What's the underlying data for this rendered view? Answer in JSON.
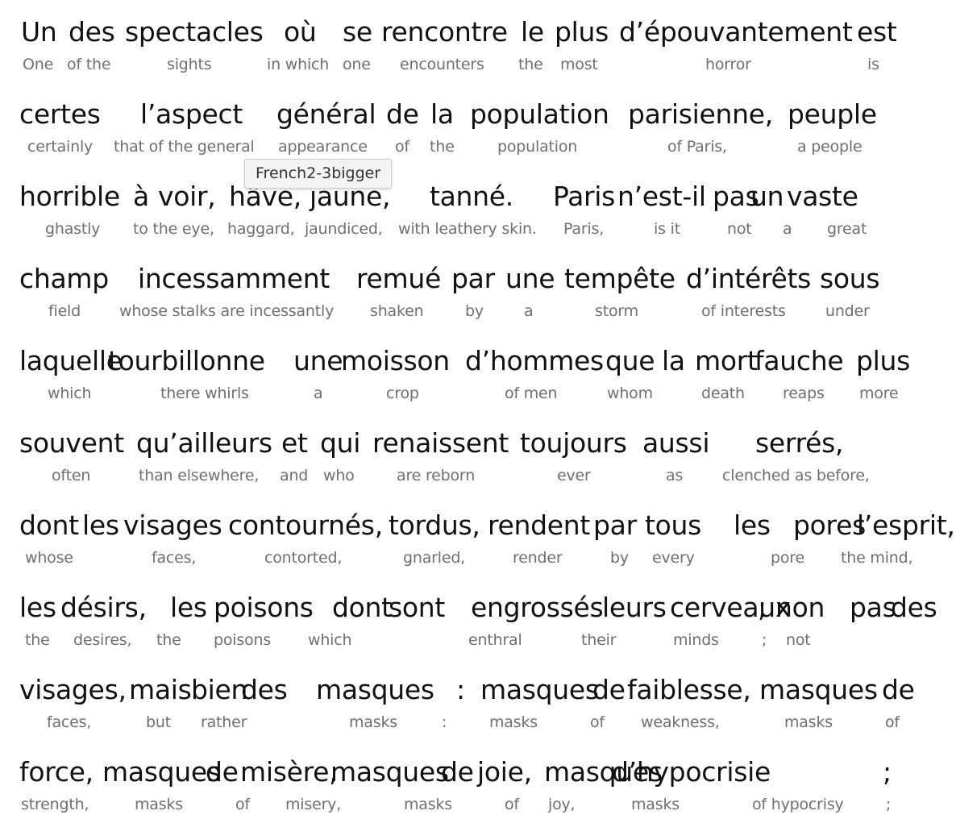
{
  "tooltip": "French2-3bigger",
  "lines": [
    {
      "fr": [
        "Un",
        "des",
        "spectacles",
        "où",
        "se",
        "rencontre",
        "le",
        "plus",
        "d’épouvantement",
        "est"
      ],
      "en": [
        "One",
        "of the",
        "sights",
        "in which",
        "one",
        "encounters",
        "the",
        "most",
        "horror",
        "is"
      ]
    },
    {
      "fr": [
        "certes",
        "l’aspect",
        "général",
        "de",
        "la",
        "population",
        "parisienne,",
        "peuple"
      ],
      "en": [
        "certainly",
        "that of the general",
        "appearance",
        "of",
        "the",
        "population",
        "of Paris,",
        "a people"
      ]
    },
    {
      "fr": [
        "horrible",
        "à",
        "voir,",
        "hâve,",
        "jaune,",
        "tanné.",
        "Paris",
        "n’est-il",
        "pas",
        "un",
        "vaste"
      ],
      "en": [
        "ghastly",
        "to the eye,",
        "haggard,",
        "jaundiced,",
        "with leathery skin.",
        "Paris,",
        "is it",
        "not",
        "a",
        "great"
      ]
    },
    {
      "fr": [
        "champ",
        "incessamment",
        "remué",
        "par",
        "une",
        "tempête",
        "d’intérêts",
        "sous"
      ],
      "en": [
        "field",
        "whose stalks are incessantly",
        "shaken",
        "by",
        "a",
        "storm",
        "of interests",
        "under"
      ]
    },
    {
      "fr": [
        "laquelle",
        "tourbillonne",
        "une",
        "moisson",
        "d’hommes",
        "que",
        "la",
        "mort",
        "fauche",
        "plus"
      ],
      "en": [
        "which",
        "there whirls",
        "a",
        "crop",
        "of men",
        "whom",
        "death",
        "reaps",
        "more"
      ]
    },
    {
      "fr": [
        "souvent",
        "qu’ailleurs",
        "et",
        "qui",
        "renaissent",
        "toujours",
        "aussi",
        "serrés,"
      ],
      "en": [
        "often",
        "than elsewhere,",
        "and",
        "who",
        "are reborn",
        "ever",
        "as",
        "clenched as before,"
      ]
    },
    {
      "fr": [
        "dont",
        "les",
        "visages",
        "contournés,",
        "tordus,",
        "rendent",
        "par",
        "tous",
        "les",
        "pores",
        "l’esprit,"
      ],
      "en": [
        "whose",
        "faces,",
        "contorted,",
        "gnarled,",
        "render",
        "by",
        "every",
        "pore",
        "the mind,"
      ]
    },
    {
      "fr": [
        "les",
        "désirs,",
        "les",
        "poisons",
        "dont",
        "sont",
        "engrossés",
        "leurs",
        "cerveaux",
        ";",
        "non",
        "pas",
        "des"
      ],
      "en": [
        "the",
        "desires,",
        "the",
        "poisons",
        "which",
        "enthral",
        "their",
        "minds",
        ";",
        "not"
      ]
    },
    {
      "fr": [
        "visages,",
        "mais",
        "bien",
        "des",
        "masques",
        ":",
        "masques",
        "de",
        "faiblesse,",
        "masques",
        "de"
      ],
      "en": [
        "faces,",
        "but",
        "rather",
        "masks",
        ":",
        "masks",
        "of",
        "weakness,",
        "masks",
        "of"
      ]
    },
    {
      "fr": [
        "force,",
        "masques",
        "de",
        "misère,",
        "masques",
        "de",
        "joie,",
        "masques",
        "d’hypocrisie",
        ";"
      ],
      "en": [
        "strength,",
        "masks",
        "of",
        "misery,",
        "masks",
        "of",
        "joy,",
        "masks",
        "of hypocrisy",
        ";"
      ]
    }
  ]
}
